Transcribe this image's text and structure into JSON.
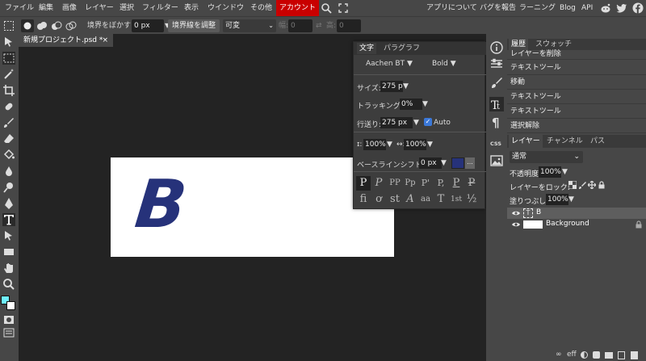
{
  "menu": {
    "items": [
      "ファイル",
      "編集",
      "画像",
      "レイヤー",
      "選択",
      "フィルター",
      "表示",
      "ウインドウ",
      "その他"
    ],
    "account": "アカウント",
    "right_links": [
      "アプリについて",
      "バグを報告",
      "ラーニング",
      "Blog",
      "API"
    ],
    "icons": [
      "search-icon",
      "fullscreen-icon",
      "reddit-icon",
      "twitter-icon",
      "facebook-icon"
    ]
  },
  "options": {
    "feather_label": "境界をぼかす:",
    "feather_value": "0 px",
    "refine_edge": "境界線を調整",
    "style_value": "可変",
    "width_label": "幅:",
    "width_value": "0",
    "height_label": "高:",
    "height_value": "0"
  },
  "document": {
    "tab_title": "新規プロジェクト.psd *",
    "close": "×",
    "canvas_text": "B",
    "text_color": "#26327a"
  },
  "text_panel": {
    "tabs": [
      "文字",
      "パラグラフ"
    ],
    "font_family": "Aachen BT",
    "font_style": "Bold",
    "size_label": "サイズ:",
    "size_value": "275 p",
    "tracking_label": "トラッキング:",
    "tracking_value": "0%",
    "leading_label": "行送り:",
    "leading_value": "275 px",
    "auto_label": "Auto",
    "auto_checked": true,
    "vscale_label": "ɪ:",
    "vscale_value": "100%",
    "hscale_label": "↔:",
    "hscale_value": "100%",
    "baseline_label": "ベースラインシフト:",
    "baseline_value": "0 px",
    "color_swatch": "#26327a",
    "more": "...",
    "glyph_row1": [
      "P",
      "P",
      "PP",
      "Pp",
      "P'",
      "P,",
      "P",
      "P"
    ],
    "glyph_row2": [
      "fi",
      "ơ",
      "st",
      "A",
      "aa",
      "T",
      "1st",
      "½"
    ]
  },
  "history": {
    "tabs": [
      "履歴",
      "スウォッチ"
    ],
    "items": [
      "レイヤーを削除",
      "テキストツール",
      "移動",
      "テキストツール",
      "テキストツール",
      "選択解除"
    ]
  },
  "layers": {
    "tabs": [
      "レイヤー",
      "チャンネル",
      "パス"
    ],
    "blend_mode": "通常",
    "opacity_label": "不透明度:",
    "opacity_value": "100%",
    "lock_label": "レイヤーをロック:",
    "fill_label": "塗りつぶし:",
    "fill_value": "100%",
    "rows": [
      {
        "name": "B",
        "type": "text"
      },
      {
        "name": "Background",
        "type": "image"
      }
    ]
  },
  "colors": {
    "foreground": "#6ff0ff",
    "background": "#ffffff",
    "accent_red": "#c90000"
  }
}
